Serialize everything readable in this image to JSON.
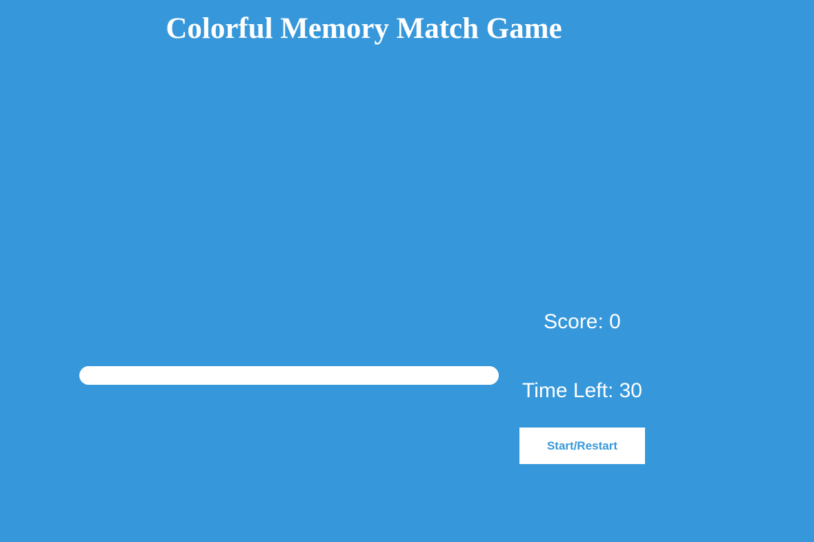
{
  "game": {
    "title": "Colorful Memory Match Game",
    "score_text": "Score: 0",
    "time_text": "Time Left: 30",
    "start_label": "Start/Restart",
    "time_progress_fraction": 1.0
  },
  "colors": {
    "background": "#3698db",
    "foreground": "#ffffff",
    "button_text": "#3698db"
  }
}
